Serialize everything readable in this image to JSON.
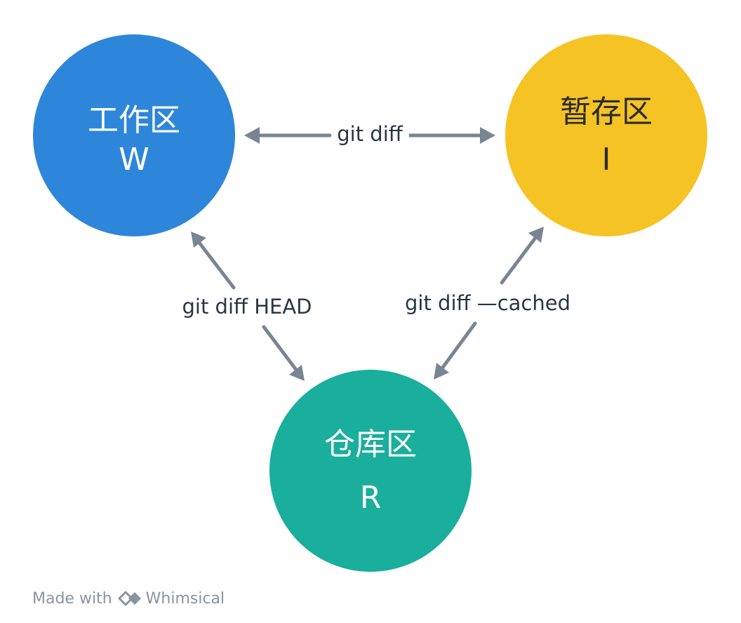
{
  "nodes": {
    "working": {
      "label": "工作区",
      "letter": "W",
      "color": "#2e86da",
      "text_color": "#ffffff"
    },
    "staging": {
      "label": "暂存区",
      "letter": "I",
      "color": "#f6c325",
      "text_color": "#2b2b2b"
    },
    "repo": {
      "label": "仓库区",
      "letter": "R",
      "color": "#1aae9c",
      "text_color": "#ffffff"
    }
  },
  "edges": {
    "working_staging": "git diff",
    "working_repo": "git diff HEAD",
    "staging_repo": "git diff —cached"
  },
  "arrow_color": "#7a8593",
  "watermark": {
    "prefix": "Made with",
    "brand": "Whimsical"
  }
}
